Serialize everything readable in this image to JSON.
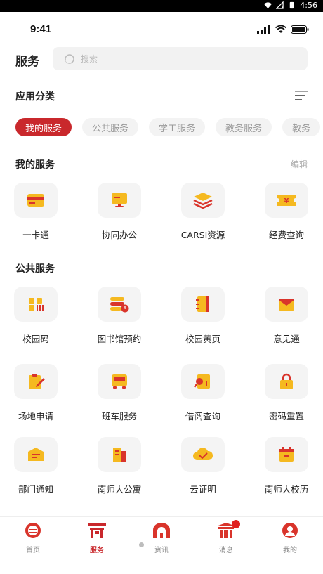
{
  "status_bar": {
    "time": "4:56"
  },
  "fake_status": {
    "time": "9:41"
  },
  "header": {
    "title": "服务",
    "search_placeholder": "搜索"
  },
  "category": {
    "title": "应用分类",
    "chips": [
      "我的服务",
      "公共服务",
      "学工服务",
      "教务服务",
      "教务"
    ]
  },
  "my_services": {
    "title": "我的服务",
    "edit_label": "编辑",
    "items": [
      {
        "label": "一卡通",
        "icon": "card-icon"
      },
      {
        "label": "协同办公",
        "icon": "monitor-icon"
      },
      {
        "label": "CARSI资源",
        "icon": "layers-icon"
      },
      {
        "label": "经费查询",
        "icon": "yuan-ticket-icon"
      }
    ]
  },
  "public_services": {
    "title": "公共服务",
    "items": [
      {
        "label": "校园码",
        "icon": "grid-code-icon"
      },
      {
        "label": "图书馆预约",
        "icon": "library-clock-icon"
      },
      {
        "label": "校园黄页",
        "icon": "notebook-icon"
      },
      {
        "label": "意见通",
        "icon": "mail-icon"
      },
      {
        "label": "场地申请",
        "icon": "clipboard-pen-icon"
      },
      {
        "label": "班车服务",
        "icon": "bus-icon"
      },
      {
        "label": "借阅查询",
        "icon": "book-search-icon"
      },
      {
        "label": "密码重置",
        "icon": "lock-icon"
      },
      {
        "label": "部门通知",
        "icon": "notice-envelope-icon"
      },
      {
        "label": "南师大公寓",
        "icon": "building-icon"
      },
      {
        "label": "云证明",
        "icon": "cloud-check-icon"
      },
      {
        "label": "南师大校历",
        "icon": "calendar-icon"
      }
    ]
  },
  "tabbar": {
    "items": [
      {
        "label": "首页",
        "icon": "home-emblem-icon"
      },
      {
        "label": "服务",
        "icon": "gate-icon"
      },
      {
        "label": "资讯",
        "icon": "arch-icon"
      },
      {
        "label": "消息",
        "icon": "pavilion-icon"
      },
      {
        "label": "我的",
        "icon": "profile-seal-icon"
      }
    ],
    "active_index": 1
  },
  "colors": {
    "brand_red": "#c9282c",
    "icon_yellow": "#f5b920",
    "icon_red": "#d9342b"
  }
}
